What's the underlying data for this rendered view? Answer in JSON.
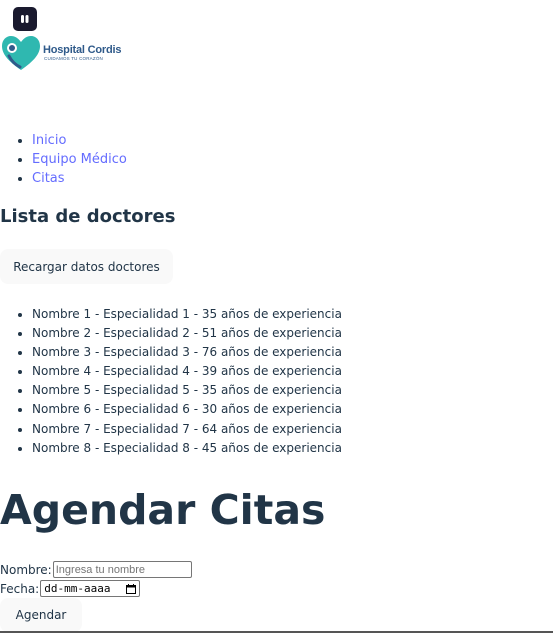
{
  "header": {
    "top_icon": "vite-dark-icon",
    "logo": {
      "title": "Hospital Cordis",
      "subtitle": "CUIDAMOS TU CORAZÓN",
      "colors": {
        "teal": "#2fb8b0",
        "blue": "#2f5a8a"
      }
    }
  },
  "nav": {
    "items": [
      {
        "label": "Inicio"
      },
      {
        "label": "Equipo Médico"
      },
      {
        "label": "Citas"
      }
    ],
    "link_color": "#646cff"
  },
  "doctors": {
    "title": "Lista de doctores",
    "reload_label": "Recargar datos doctores",
    "items": [
      "Nombre 1 - Especialidad 1 - 35 años de experiencia",
      "Nombre 2 - Especialidad 2 - 51 años de experiencia",
      "Nombre 3 - Especialidad 3 - 76 años de experiencia",
      "Nombre 4 - Especialidad 4 - 39 años de experiencia",
      "Nombre 5 - Especialidad 5 - 35 años de experiencia",
      "Nombre 6 - Especialidad 6 - 30 años de experiencia",
      "Nombre 7 - Especialidad 7 - 64 años de experiencia",
      "Nombre 8 - Especialidad 8 - 45 años de experiencia"
    ]
  },
  "appointments": {
    "title": "Agendar Citas",
    "name_label": "Nombre:",
    "name_placeholder": "Ingresa tu nombre",
    "date_label": "Fecha:",
    "date_placeholder": "dd-mm-aaaa",
    "submit_label": "Agendar"
  },
  "colors": {
    "text": "#213547",
    "button_bg": "#f9f9f9"
  }
}
